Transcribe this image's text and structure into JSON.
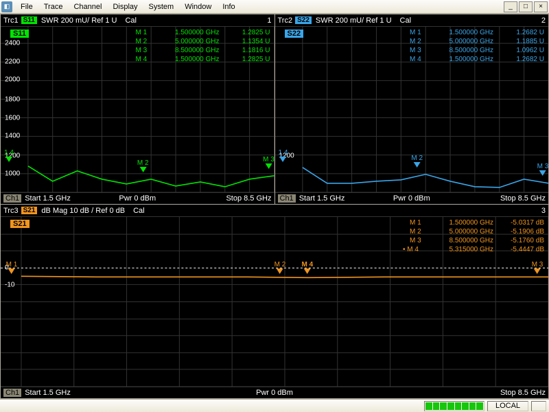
{
  "menu": {
    "items": [
      "File",
      "Trace",
      "Channel",
      "Display",
      "System",
      "Window",
      "Info"
    ]
  },
  "window_buttons": {
    "min": "_",
    "max": "□",
    "close": "×"
  },
  "panel1": {
    "header": {
      "trc": "Trc1",
      "sp": "S11",
      "fmt": "SWR  200 mU/  Ref 1 U",
      "cal": "Cal",
      "num": "1"
    },
    "sparam": "S11",
    "markers": [
      {
        "m": "M 1",
        "f": "1.500000 GHz",
        "v": "1.2825 U"
      },
      {
        "m": "M 2",
        "f": "5.000000 GHz",
        "v": "1.1354 U"
      },
      {
        "m": "M 3",
        "f": "8.500000 GHz",
        "v": "1.1816 U"
      },
      {
        "m": "M 4",
        "f": "1.500000 GHz",
        "v": "1.2825 U"
      }
    ],
    "ylabels": [
      "2400",
      "2200",
      "2000",
      "1800",
      "1600",
      "1400",
      "1200",
      "1000"
    ],
    "footer": {
      "ch": "Ch1",
      "start": "Start  1.5 GHz",
      "pwr": "Pwr  0 dBm",
      "stop": "Stop  8.5 GHz"
    }
  },
  "panel2": {
    "header": {
      "trc": "Trc2",
      "sp": "S22",
      "fmt": "SWR  200 mU/  Ref 1 U",
      "cal": "Cal",
      "num": "2"
    },
    "sparam": "S22",
    "markers": [
      {
        "m": "M 1",
        "f": "1.500000 GHz",
        "v": "1.2682 U"
      },
      {
        "m": "M 2",
        "f": "5.000000 GHz",
        "v": "1.1885 U"
      },
      {
        "m": "M 3",
        "f": "8.500000 GHz",
        "v": "1.0962 U"
      },
      {
        "m": "M 4",
        "f": "1.500000 GHz",
        "v": "1.2682 U"
      }
    ],
    "footer": {
      "ch": "Ch1",
      "start": "Start  1.5 GHz",
      "pwr": "Pwr  0 dBm",
      "stop": "Stop  8.5 GHz"
    }
  },
  "panel3": {
    "header": {
      "trc": "Trc3",
      "sp": "S21",
      "fmt": "dB Mag  10 dB /  Ref 0 dB",
      "cal": "Cal",
      "num": "3"
    },
    "sparam": "S21",
    "markers": [
      {
        "m": "M 1",
        "f": "1.500000 GHz",
        "v": "-5.0317  dB"
      },
      {
        "m": "M 2",
        "f": "5.000000 GHz",
        "v": "-5.1906  dB"
      },
      {
        "m": "M 3",
        "f": "8.500000 GHz",
        "v": "-5.1760  dB"
      },
      {
        "m": "• M 4",
        "f": "5.315000 GHz",
        "v": "-5.4447  dB"
      }
    ],
    "ylabels": [
      "0",
      "-10"
    ],
    "footer": {
      "ch": "Ch1",
      "start": "Start  1.5 GHz",
      "pwr": "Pwr  0 dBm",
      "stop": "Stop  8.5 GHz"
    }
  },
  "marker_labels": {
    "m1": "M 1",
    "m2": "M 2",
    "m3": "M 3",
    "m4": "M 4",
    "m14": "1 4"
  },
  "status": {
    "local": "LOCAL"
  },
  "chart_data": [
    {
      "type": "line",
      "title": "S11 SWR",
      "name": "S11",
      "x_range_GHz": [
        1.5,
        8.5
      ],
      "y_unit": "U",
      "y_ref": 1.0,
      "y_div": 0.2,
      "ylim": [
        1.0,
        2.8
      ],
      "markers": [
        {
          "id": 1,
          "x": 1.5,
          "y": 1.2825
        },
        {
          "id": 2,
          "x": 5.0,
          "y": 1.1354
        },
        {
          "id": 3,
          "x": 8.5,
          "y": 1.1816
        },
        {
          "id": 4,
          "x": 1.5,
          "y": 1.2825
        }
      ],
      "trace_samples": {
        "x": [
          1.5,
          2.2,
          2.9,
          3.6,
          4.3,
          5.0,
          5.7,
          6.4,
          7.1,
          7.8,
          8.5
        ],
        "y": [
          1.28,
          1.12,
          1.23,
          1.14,
          1.09,
          1.14,
          1.07,
          1.11,
          1.06,
          1.14,
          1.18
        ]
      }
    },
    {
      "type": "line",
      "title": "S22 SWR",
      "name": "S22",
      "x_range_GHz": [
        1.5,
        8.5
      ],
      "y_unit": "U",
      "y_ref": 1.0,
      "y_div": 0.2,
      "ylim": [
        1.0,
        2.8
      ],
      "markers": [
        {
          "id": 1,
          "x": 1.5,
          "y": 1.2682
        },
        {
          "id": 2,
          "x": 5.0,
          "y": 1.1885
        },
        {
          "id": 3,
          "x": 8.5,
          "y": 1.0962
        },
        {
          "id": 4,
          "x": 1.5,
          "y": 1.2682
        }
      ],
      "trace_samples": {
        "x": [
          1.5,
          2.2,
          2.9,
          3.6,
          4.3,
          5.0,
          5.7,
          6.4,
          7.1,
          7.8,
          8.5
        ],
        "y": [
          1.27,
          1.1,
          1.1,
          1.12,
          1.13,
          1.19,
          1.12,
          1.06,
          1.05,
          1.14,
          1.1
        ]
      }
    },
    {
      "type": "line",
      "title": "S21 dB Mag",
      "name": "S21",
      "x_range_GHz": [
        1.5,
        8.5
      ],
      "y_unit": "dB",
      "y_ref": 0,
      "y_div": 10,
      "ylim": [
        -70,
        30
      ],
      "markers": [
        {
          "id": 1,
          "x": 1.5,
          "y": -5.0317
        },
        {
          "id": 2,
          "x": 5.0,
          "y": -5.1906
        },
        {
          "id": 3,
          "x": 8.5,
          "y": -5.176
        },
        {
          "id": 4,
          "x": 5.315,
          "y": -5.4447
        }
      ],
      "trace_samples": {
        "x": [
          1.5,
          2.5,
          3.5,
          4.5,
          5.315,
          6.5,
          7.5,
          8.5
        ],
        "y": [
          -5.03,
          -5.1,
          -5.15,
          -5.18,
          -5.44,
          -5.2,
          -5.18,
          -5.18
        ]
      }
    }
  ]
}
